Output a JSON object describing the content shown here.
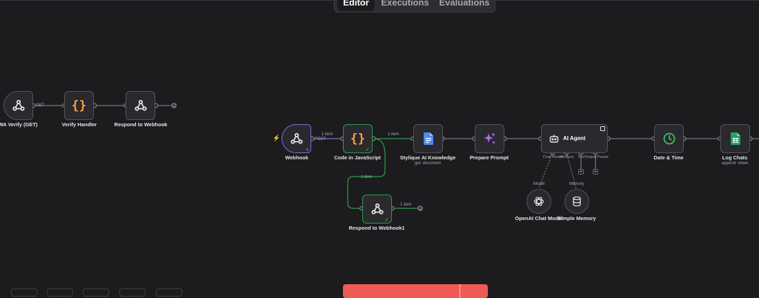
{
  "tabs": {
    "editor": "Editor",
    "executions": "Executions",
    "evaluations": "Evaluations",
    "active": "editor"
  },
  "workflow_top": {
    "nodes": {
      "wa_verify": {
        "label": "WA Verify (GET)",
        "icon": "webhook-icon"
      },
      "verify_handler": {
        "label": "Verify Handler",
        "icon": "code-icon"
      },
      "respond_top": {
        "label": "Respond to Webhook",
        "icon": "webhook-icon"
      }
    },
    "edge_labels": {
      "wa_to_verify": "GET"
    }
  },
  "workflow_main": {
    "nodes": {
      "webhook": {
        "label": "Webhook",
        "icon": "webhook-icon"
      },
      "code_js": {
        "label": "Code in JavaScript",
        "icon": "code-icon"
      },
      "knowledge": {
        "label": "Stylique AI Knowledge",
        "sub": "get: document",
        "icon": "google-docs-icon"
      },
      "prepare_prompt": {
        "label": "Prepare Prompt",
        "icon": "sparkles-icon"
      },
      "ai_agent": {
        "label": "AI Agent",
        "icon": "robot-icon",
        "ports": [
          "Chat Model",
          "Memory",
          "Tool",
          "Output Parser"
        ]
      },
      "openai_model": {
        "label": "OpenAI Chat Model",
        "icon": "openai-icon"
      },
      "simple_memory": {
        "label": "Simple Memory",
        "icon": "database-icon"
      },
      "date_time": {
        "label": "Date & Time",
        "icon": "clock-icon"
      },
      "log_chats": {
        "label": "Log Chats",
        "sub": "append: sheet",
        "icon": "google-sheets-icon"
      },
      "respond_webhook1": {
        "label": "Respond to Webhook1",
        "icon": "webhook-icon"
      }
    },
    "edge_labels": {
      "webhook_to_code": "1 item",
      "webhook_method": "POST",
      "code_to_knowledge": "1 item",
      "code_to_respond": "1 item",
      "respond_out": "1 item",
      "model_label": "Model",
      "memory_label": "Memory"
    }
  },
  "colors": {
    "background": "#1c1b1e",
    "node_fill": "#2a292d",
    "node_border": "#56555b",
    "success_green": "#2e9e4f",
    "trigger_purple": "#7f6fe0",
    "test_button": "#ef5a55",
    "code_orange": "#ff9f40",
    "docs_blue": "#4a8af4",
    "sheets_green": "#1fa463"
  }
}
